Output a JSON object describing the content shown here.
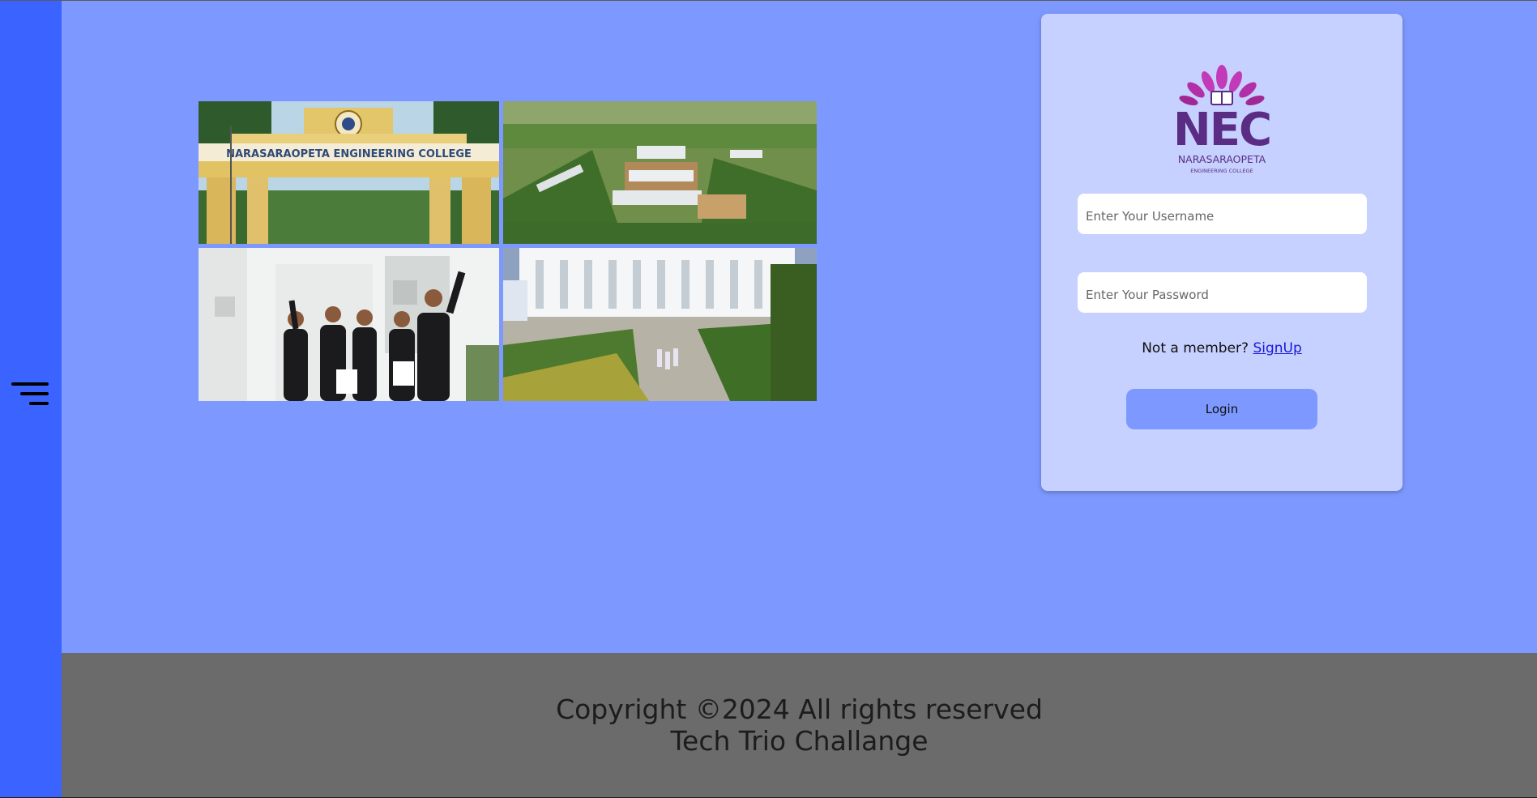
{
  "colors": {
    "page_background": "#7d98ff",
    "sidebar": "#3a63ff",
    "footer": "#6b6b6b",
    "card": "#c6d1ff",
    "login_button": "#7d98ff",
    "link": "#1a1ad8",
    "logo_purple": "#5b2c83",
    "logo_magenta": "#c33ab8"
  },
  "sidebar": {
    "menu_icon": "hamburger-menu-icon"
  },
  "gallery": {
    "images": [
      {
        "name": "college-gate-photo",
        "sign_text": "NARASARAOPETA ENGINEERING COLLEGE"
      },
      {
        "name": "campus-aerial-photo"
      },
      {
        "name": "graduates-celebrating-photo"
      },
      {
        "name": "campus-building-photo"
      }
    ]
  },
  "login": {
    "logo": {
      "acronym": "NEC",
      "name": "NARASARAOPETA",
      "subtitle": "ENGINEERING COLLEGE"
    },
    "username_placeholder": "Enter Your Username",
    "password_placeholder": "Enter Your Password",
    "not_member_text": "Not a member?",
    "signup_link": "SignUp",
    "login_button": "Login"
  },
  "footer": {
    "copyright": "Copyright ©2024 All rights reserved",
    "team": "Tech Trio Challange"
  }
}
